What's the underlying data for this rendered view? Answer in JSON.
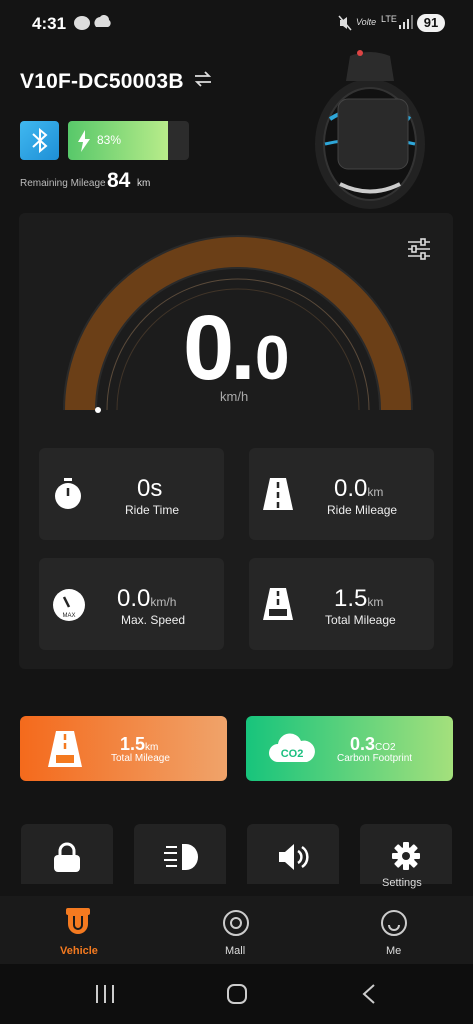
{
  "status_bar": {
    "time": "4:31",
    "network": "LTE",
    "battery": "91"
  },
  "header": {
    "device_name": "V10F-DC50003B",
    "battery_percent_label": "83%",
    "battery_level": 0.83,
    "remaining_label": "Remaining Mileage",
    "remaining_value": "84",
    "remaining_unit": "km"
  },
  "speedometer": {
    "speed_int": "0.",
    "speed_dec": "0",
    "unit": "km/h"
  },
  "stats": [
    {
      "value": "0s",
      "unit": "",
      "label": "Ride Time",
      "icon": "stopwatch-icon"
    },
    {
      "value": "0.0",
      "unit": "km",
      "label": "Ride Mileage",
      "icon": "road-icon"
    },
    {
      "value": "0.0",
      "unit": "km/h",
      "label": "Max. Speed",
      "icon": "speedometer-max-icon"
    },
    {
      "value": "1.5",
      "unit": "km",
      "label": "Total Mileage",
      "icon": "road-odo-icon"
    }
  ],
  "promos": [
    {
      "value": "1.5",
      "unit": "km",
      "label": "Total Mileage",
      "color_from": "#f46a1c",
      "color_to": "#f0a36a"
    },
    {
      "value": "0.3",
      "unit": "CO2",
      "label": "Carbon Footprint",
      "icon_text": "CO2",
      "color_from": "#17c47c",
      "color_to": "#a4e07c"
    }
  ],
  "quick_buttons": [
    {
      "icon": "lock-icon",
      "label": ""
    },
    {
      "icon": "headlight-icon",
      "label": ""
    },
    {
      "icon": "speaker-icon",
      "label": ""
    },
    {
      "icon": "gear-icon",
      "label": "Settings"
    }
  ],
  "nav": {
    "items": [
      {
        "label": "Vehicle",
        "icon": "vehicle-icon",
        "active": true
      },
      {
        "label": "Mall",
        "icon": "mall-icon"
      },
      {
        "label": "Me",
        "icon": "me-icon"
      }
    ],
    "accent": "#f47a20"
  }
}
